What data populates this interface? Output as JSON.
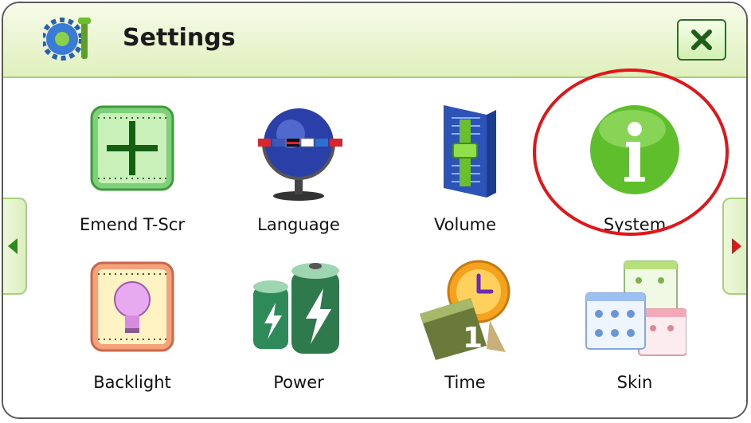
{
  "window": {
    "title": "Settings"
  },
  "title_icon": "settings-gear-wrench-icon",
  "close_button": {
    "icon": "close-x-icon",
    "symbol": "✕"
  },
  "nav": {
    "prev_icon": "arrow-left-icon",
    "next_icon": "arrow-right-icon"
  },
  "tiles": [
    {
      "label": "Emend T-Scr",
      "icon": "crosshair-ruler-icon"
    },
    {
      "label": "Language",
      "icon": "globe-flags-icon"
    },
    {
      "label": "Volume",
      "icon": "volume-slider-icon"
    },
    {
      "label": "System",
      "icon": "info-circle-icon"
    },
    {
      "label": "Backlight",
      "icon": "lightbulb-icon"
    },
    {
      "label": "Power",
      "icon": "battery-icon"
    },
    {
      "label": "Time",
      "icon": "clock-calendar-icon"
    },
    {
      "label": "Skin",
      "icon": "skin-windows-icon"
    }
  ],
  "colors": {
    "accent_green": "#6bbf2a",
    "highlight_red": "#e0161a",
    "title_bg": "#e9f4cf"
  }
}
